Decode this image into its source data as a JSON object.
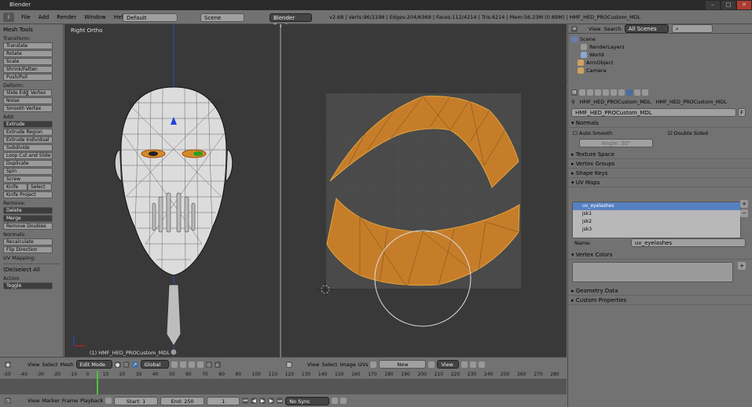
{
  "window": {
    "title": "Blender"
  },
  "topbar": {
    "menu": [
      "File",
      "Add",
      "Render",
      "Window",
      "Help"
    ],
    "layout": "Default",
    "scene": "Scene",
    "engine": "Blender Render",
    "stats": "v2.68 | Verts:96/2198 | Edges:204/6369 | Faces:112/4214 | Tris:4214 | Mem:56.23M (0.89M) | HMF_HED_PROCustom_MDL"
  },
  "toolshelf": {
    "title": "Mesh Tools",
    "transform_label": "Transform:",
    "transform": [
      "Translate",
      "Rotate",
      "Scale",
      "Shrink/Fatten",
      "Push/Pull"
    ],
    "deform_label": "Deform:",
    "slide_edge": "Slide Edge",
    "vertex": "Vertex",
    "deform": [
      "Noise",
      "Smooth Vertex"
    ],
    "add_label": "Add:",
    "extrude_dropdown": "Extrude",
    "add": [
      "Extrude Region",
      "Extrude Individual",
      "Subdivide",
      "Loop Cut and Slide",
      "Duplicate",
      "Spin",
      "Screw"
    ],
    "knife": "Knife",
    "select": "Select",
    "knife_project": "Knife Project",
    "remove_label": "Remove:",
    "delete_dropdown": "Delete",
    "merge_dropdown": "Merge",
    "remove_doubles": "Remove Doubles",
    "normals_label": "Normals:",
    "normals": [
      "Recalculate",
      "Flip Direction"
    ],
    "uv_label": "UV Mapping:",
    "deselect_all": "(De)select All",
    "action_label": "Action",
    "action_value": "Toggle"
  },
  "viewport3d": {
    "view_name": "Right Ortho",
    "object_label": "(1) HMF_HED_PROCustom_MDL",
    "header": {
      "menus": [
        "View",
        "Select",
        "Mesh"
      ],
      "mode": "Edit Mode",
      "pivot": "Global"
    }
  },
  "uv_editor": {
    "header": {
      "menus": [
        "View",
        "Select",
        "Image",
        "UVs"
      ],
      "image": "New",
      "view": "View"
    }
  },
  "outliner": {
    "view": "View",
    "search": "Search",
    "scenes_dropdown": "All Scenes",
    "items": [
      "Scene",
      "RenderLayers",
      "World",
      "ArmObject",
      "Camera"
    ]
  },
  "properties": {
    "breadcrumb": [
      "HMF_HED_PROCustom_MDL",
      "HMF_HED_PROCustom_MDL"
    ],
    "datablock": "HMF_HED_PROCustom_MDL",
    "datablock_flag": "F",
    "normals_panel": "Normals",
    "auto_smooth": "Auto Smooth",
    "double_sided": "Double Sided",
    "angle": "Angle: 30°",
    "texture_space": "Texture Space",
    "vertex_groups": "Vertex Groups",
    "shape_keys": "Shape Keys",
    "uv_maps": "UV Maps",
    "uv_list": [
      "uv_eyelashes",
      "jsk1",
      "jsk2",
      "jsk3"
    ],
    "name_label": "Name:",
    "name_value": "uv_eyelashes",
    "vertex_colors": "Vertex Colors",
    "geometry_data": "Geometry Data",
    "custom_properties": "Custom Properties"
  },
  "timeline": {
    "ticks": [
      "-50",
      "-40",
      "-30",
      "-20",
      "-10",
      "0",
      "10",
      "20",
      "30",
      "40",
      "50",
      "60",
      "70",
      "80",
      "90",
      "100",
      "110",
      "120",
      "130",
      "140",
      "150",
      "160",
      "170",
      "180",
      "190",
      "200",
      "210",
      "220",
      "230",
      "240",
      "250",
      "260",
      "270",
      "280"
    ],
    "menus": [
      "View",
      "Marker",
      "Frame",
      "Playback"
    ],
    "start": "Start: 1",
    "end": "End: 250",
    "current": "1",
    "sync": "No Sync"
  },
  "colors": {
    "uv_fill": "#c67d2a",
    "selected_row": "#5680c2",
    "mesh_white": "#e6e6e6"
  }
}
